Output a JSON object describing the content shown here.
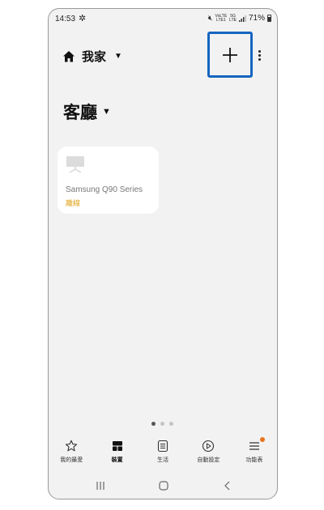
{
  "status_bar": {
    "time": "14:53",
    "fan_icon": "fan-icon",
    "volte_top": "VoLTE",
    "volte_bottom": "LTE1",
    "network_top": "5G",
    "network_bottom": "LTE",
    "battery_pct": "71%"
  },
  "header": {
    "home_label": "我家",
    "add_icon": "plus-icon",
    "more_icon": "more-vertical-icon"
  },
  "room": {
    "title": "客廳"
  },
  "device": {
    "name": "Samsung Q90 Series",
    "status": "離線",
    "status_color": "#e0a31a"
  },
  "pager": {
    "pages": 3,
    "current": 1
  },
  "bottom_nav": {
    "items": [
      {
        "label": "我的最愛",
        "icon": "star-icon"
      },
      {
        "label": "裝置",
        "icon": "devices-icon",
        "active": true
      },
      {
        "label": "生活",
        "icon": "life-icon"
      },
      {
        "label": "自動設定",
        "icon": "play-circle-icon"
      },
      {
        "label": "功能表",
        "icon": "menu-icon",
        "badge_color": "#e8731c"
      }
    ]
  },
  "system_nav": {
    "recents_icon": "recents-icon",
    "home_icon": "home-button-icon",
    "back_icon": "back-icon"
  },
  "colors": {
    "accent_outline": "#1565c0",
    "background": "#f2f2f2",
    "card": "#ffffff"
  }
}
